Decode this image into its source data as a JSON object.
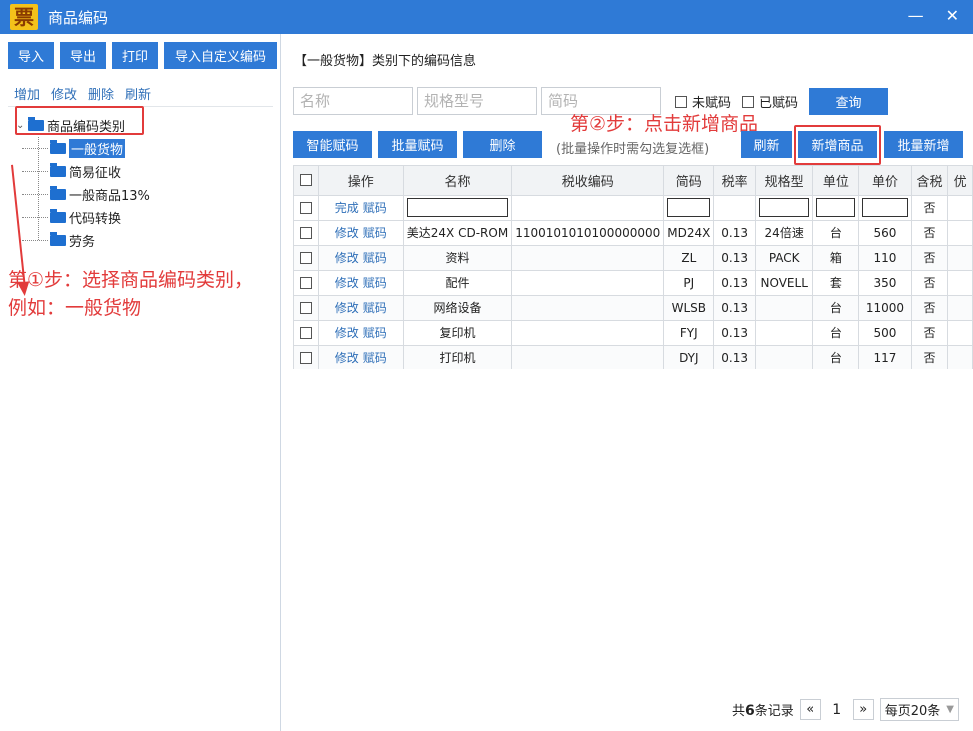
{
  "window": {
    "title": "商品编码",
    "logo_char": "票",
    "min": "—",
    "close": "✕"
  },
  "left": {
    "toolbar": [
      "导入",
      "导出",
      "打印",
      "导入自定义编码"
    ],
    "links": [
      "增加",
      "修改",
      "删除",
      "刷新"
    ],
    "tree": {
      "toggle": "⌄",
      "root": "商品编码类别",
      "children": [
        "一般货物",
        "简易征收",
        "一般商品13%",
        "代码转换",
        "劳务"
      ],
      "selected_index": 0
    },
    "step1_line1": "第①步：选择商品编码类别，",
    "step1_line2": "例如：一般货物"
  },
  "right": {
    "title": "【一般货物】类别下的编码信息",
    "search": {
      "name": "名称",
      "spec": "规格型号",
      "short": "简码"
    },
    "checks": [
      "未赋码",
      "已赋码"
    ],
    "query": "查询",
    "step2": "第②步：点击新增商品",
    "actions": {
      "smart": "智能赋码",
      "batch": "批量赋码",
      "delete": "删除",
      "hint": "(批量操作时需勾选复选框)",
      "refresh": "刷新",
      "add": "新增商品",
      "batch_add": "批量新增"
    }
  },
  "table": {
    "headers": [
      "操作",
      "名称",
      "税收编码",
      "简码",
      "税率",
      "规格型",
      "单位",
      "单价",
      "含税",
      "优"
    ],
    "edit_row": {
      "ops": [
        "完成",
        "赋码"
      ],
      "tax": "否"
    },
    "row_ops": [
      "修改",
      "赋码"
    ],
    "rows": [
      {
        "name": "美达24X CD-ROM",
        "code": "1100101010100000000",
        "short": "MD24X",
        "rate": "0.13",
        "spec": "24倍速",
        "unit": "台",
        "price": "560",
        "tax": "否"
      },
      {
        "name": "资料",
        "code": "",
        "short": "ZL",
        "rate": "0.13",
        "spec": "PACK",
        "unit": "箱",
        "price": "110",
        "tax": "否"
      },
      {
        "name": "配件",
        "code": "",
        "short": "PJ",
        "rate": "0.13",
        "spec": "NOVELL",
        "unit": "套",
        "price": "350",
        "tax": "否"
      },
      {
        "name": "网络设备",
        "code": "",
        "short": "WLSB",
        "rate": "0.13",
        "spec": "",
        "unit": "台",
        "price": "11000",
        "tax": "否"
      },
      {
        "name": "复印机",
        "code": "",
        "short": "FYJ",
        "rate": "0.13",
        "spec": "",
        "unit": "台",
        "price": "500",
        "tax": "否"
      },
      {
        "name": "打印机",
        "code": "",
        "short": "DYJ",
        "rate": "0.13",
        "spec": "",
        "unit": "台",
        "price": "117",
        "tax": "否"
      }
    ]
  },
  "pager": {
    "prefix": "共",
    "count": "6",
    "suffix": "条记录",
    "prev": "«",
    "page": "1",
    "next": "»",
    "per_page": "每页20条"
  }
}
